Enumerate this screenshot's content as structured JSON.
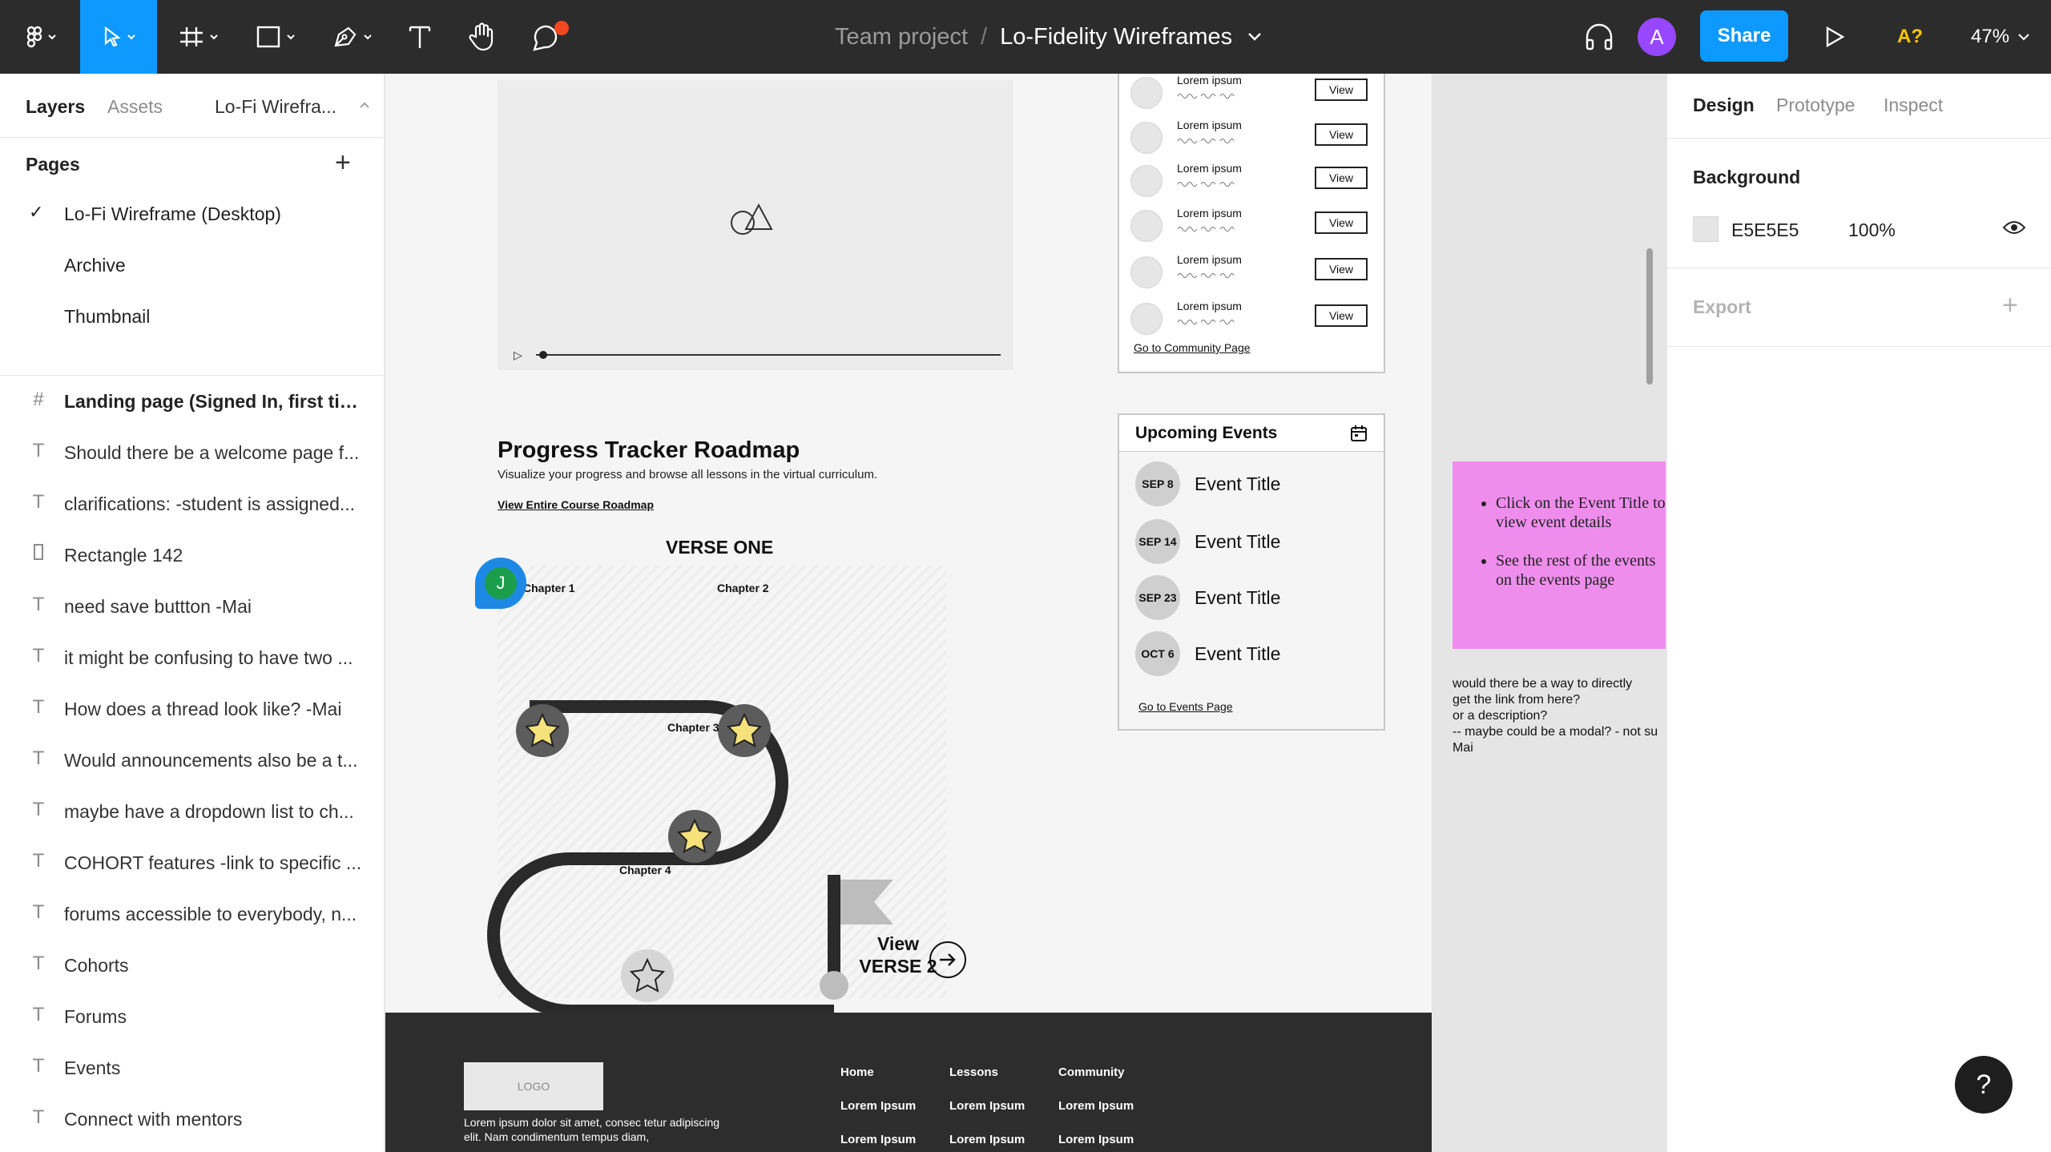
{
  "toolbar": {
    "team": "Team project",
    "separator": "/",
    "file": "Lo-Fidelity Wireframes",
    "share": "Share",
    "avatar_initial": "A",
    "access": "A?",
    "zoom": "47%",
    "accent": "#0d99ff",
    "icons": [
      "figma-menu-icon",
      "move-tool-icon",
      "frame-tool-icon",
      "shape-tool-icon",
      "pen-tool-icon",
      "text-tool-icon",
      "hand-tool-icon",
      "comment-tool-icon",
      "audio-headphones-icon",
      "present-play-icon"
    ]
  },
  "left_panel": {
    "tabs": [
      "Layers",
      "Assets"
    ],
    "page_dropdown": "Lo-Fi Wirefra...",
    "pages_title": "Pages",
    "pages": [
      "Lo-Fi Wireframe (Desktop)",
      "Archive",
      "Thumbnail"
    ],
    "layers": [
      {
        "name": "Landing page (Signed In, first time)",
        "icon": "frame-icon"
      },
      {
        "name": "Should there be a welcome page f...",
        "icon": "text-icon"
      },
      {
        "name": "clarifications: -student is assigned...",
        "icon": "text-icon"
      },
      {
        "name": "Rectangle 142",
        "icon": "rectangle-icon"
      },
      {
        "name": "need save buttton -Mai",
        "icon": "text-icon"
      },
      {
        "name": "it might be confusing to have two ...",
        "icon": "text-icon"
      },
      {
        "name": "How does a thread look like? -Mai",
        "icon": "text-icon"
      },
      {
        "name": "Would announcements also be a t...",
        "icon": "text-icon"
      },
      {
        "name": "maybe have a dropdown list to ch...",
        "icon": "text-icon"
      },
      {
        "name": "COHORT features -link to specific ...",
        "icon": "text-icon"
      },
      {
        "name": "forums accessible to everybody, n...",
        "icon": "text-icon"
      },
      {
        "name": "Cohorts",
        "icon": "text-icon"
      },
      {
        "name": "Forums",
        "icon": "text-icon"
      },
      {
        "name": "Events",
        "icon": "text-icon"
      },
      {
        "name": "Connect with mentors",
        "icon": "text-icon"
      }
    ]
  },
  "canvas": {
    "tracker": {
      "title": "Progress Tracker Roadmap",
      "subtitle": "Visualize your progress and browse all lessons in the virtual curriculum.",
      "link": "View Entire Course Roadmap",
      "verse": "VERSE ONE",
      "chapters": [
        "Chapter 1",
        "Chapter 2",
        "Chapter 3",
        "Chapter 4"
      ],
      "view_next_1": "View",
      "view_next_2": "VERSE 2",
      "collaborator": "J"
    },
    "community": {
      "rows": [
        {
          "name": "Lorem ipsum",
          "button": "View"
        },
        {
          "name": "Lorem ipsum",
          "button": "View"
        },
        {
          "name": "Lorem ipsum",
          "button": "View"
        },
        {
          "name": "Lorem ipsum",
          "button": "View"
        },
        {
          "name": "Lorem ipsum",
          "button": "View"
        },
        {
          "name": "Lorem ipsum",
          "button": "View"
        }
      ],
      "link": "Go to Community Page"
    },
    "events": {
      "title": "Upcoming Events",
      "items": [
        {
          "date": "SEP 8",
          "title": "Event Title"
        },
        {
          "date": "SEP 14",
          "title": "Event Title"
        },
        {
          "date": "SEP 23",
          "title": "Event Title"
        },
        {
          "date": "OCT 6",
          "title": "Event Title"
        }
      ],
      "link": "Go to Events Page"
    },
    "sticky": {
      "items": [
        "Click on the Event Title to view event details",
        "See the rest of the events on the events page"
      ],
      "color": "#ef8ded"
    },
    "comment": "would there be a way to directly\nget the link from here?\nor a description?\n-- maybe could be a modal? - not su\nMai",
    "footer": {
      "logo": "LOGO",
      "text": "Lorem ipsum dolor sit amet, consec tetur adipiscing elit. Nam condimentum tempus diam,",
      "columns": [
        {
          "head": "Home",
          "items": [
            "Lorem Ipsum",
            "Lorem Ipsum"
          ]
        },
        {
          "head": "Lessons",
          "items": [
            "Lorem Ipsum",
            "Lorem Ipsum"
          ]
        },
        {
          "head": "Community",
          "items": [
            "Lorem Ipsum",
            "Lorem Ipsum"
          ]
        }
      ]
    }
  },
  "right_panel": {
    "tabs": [
      "Design",
      "Prototype",
      "Inspect"
    ],
    "background_title": "Background",
    "background_hex": "E5E5E5",
    "background_opacity": "100%",
    "export_title": "Export"
  },
  "help": "?"
}
